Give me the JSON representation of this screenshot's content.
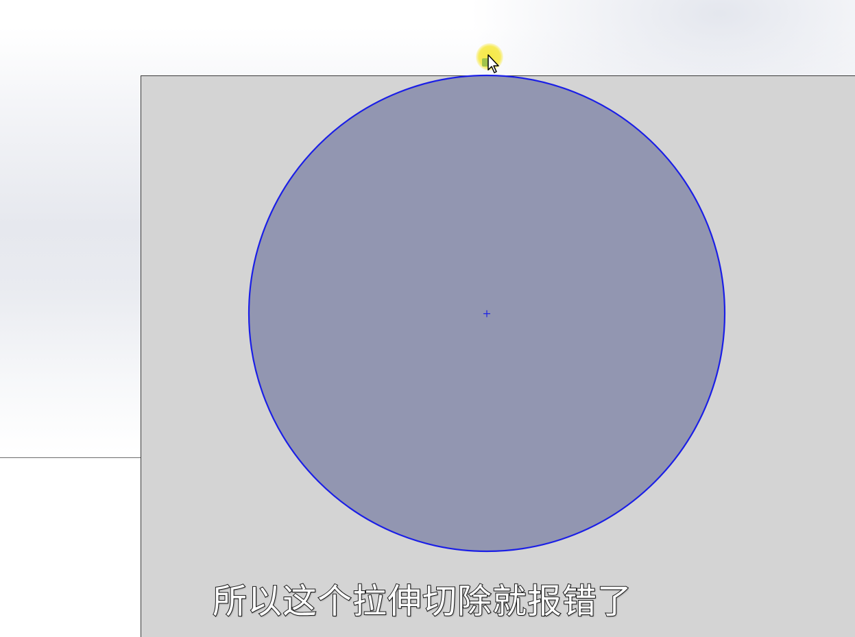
{
  "canvas": {
    "plate_color": "#d4d4d4",
    "circle_fill": "#9094b0",
    "circle_stroke": "#1a1ee6",
    "background_color": "#eceef2"
  },
  "sketch": {
    "shape": "circle",
    "center_marker": "origin-plus-icon"
  },
  "cursor": {
    "icon": "arrow-cursor-icon",
    "snap_icon": "coincident-snap-icon",
    "highlight_color": "#f6e83c"
  },
  "subtitle": {
    "text": "所以这个拉伸切除就报错了"
  }
}
